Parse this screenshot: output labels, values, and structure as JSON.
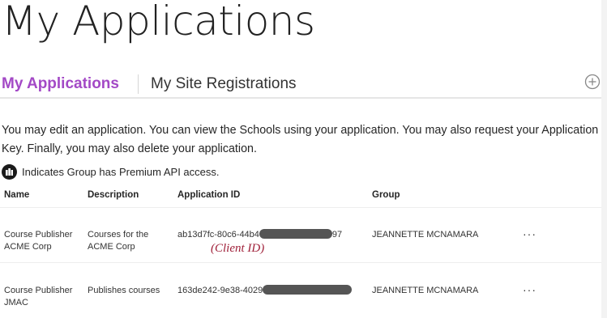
{
  "page": {
    "title": "My Applications"
  },
  "tabs": [
    {
      "label": "My Applications",
      "active": true
    },
    {
      "label": "My Site Registrations",
      "active": false
    }
  ],
  "intro": "You may edit an application. You can view the Schools using your application. You may also request your Application Key. Finally, you may also delete your application.",
  "premium_note": "Indicates Group has Premium API access.",
  "table": {
    "columns": [
      "Name",
      "Description",
      "Application ID",
      "Group"
    ],
    "rows": [
      {
        "name": "Course Publisher ACME Corp",
        "description": "Courses for the ACME Corp",
        "app_id_prefix": "ab13d7fc-80c6-44b4",
        "app_id_suffix": "97",
        "group": "JEANNETTE MCNAMARA",
        "actions": "···"
      },
      {
        "name": "Course Publisher JMAC",
        "description": "Publishes courses",
        "app_id_prefix": "163de242-9e38-4029",
        "app_id_suffix": "",
        "group": "JEANNETTE MCNAMARA",
        "actions": "···"
      }
    ]
  },
  "annotation": "(Client ID)",
  "colors": {
    "accent": "#a349c6",
    "annotation": "#a0213a",
    "redaction": "#555555"
  },
  "icons": {
    "add": "plus-circle-icon",
    "premium": "premium-api-icon",
    "row_menu": "more-horizontal-icon"
  }
}
